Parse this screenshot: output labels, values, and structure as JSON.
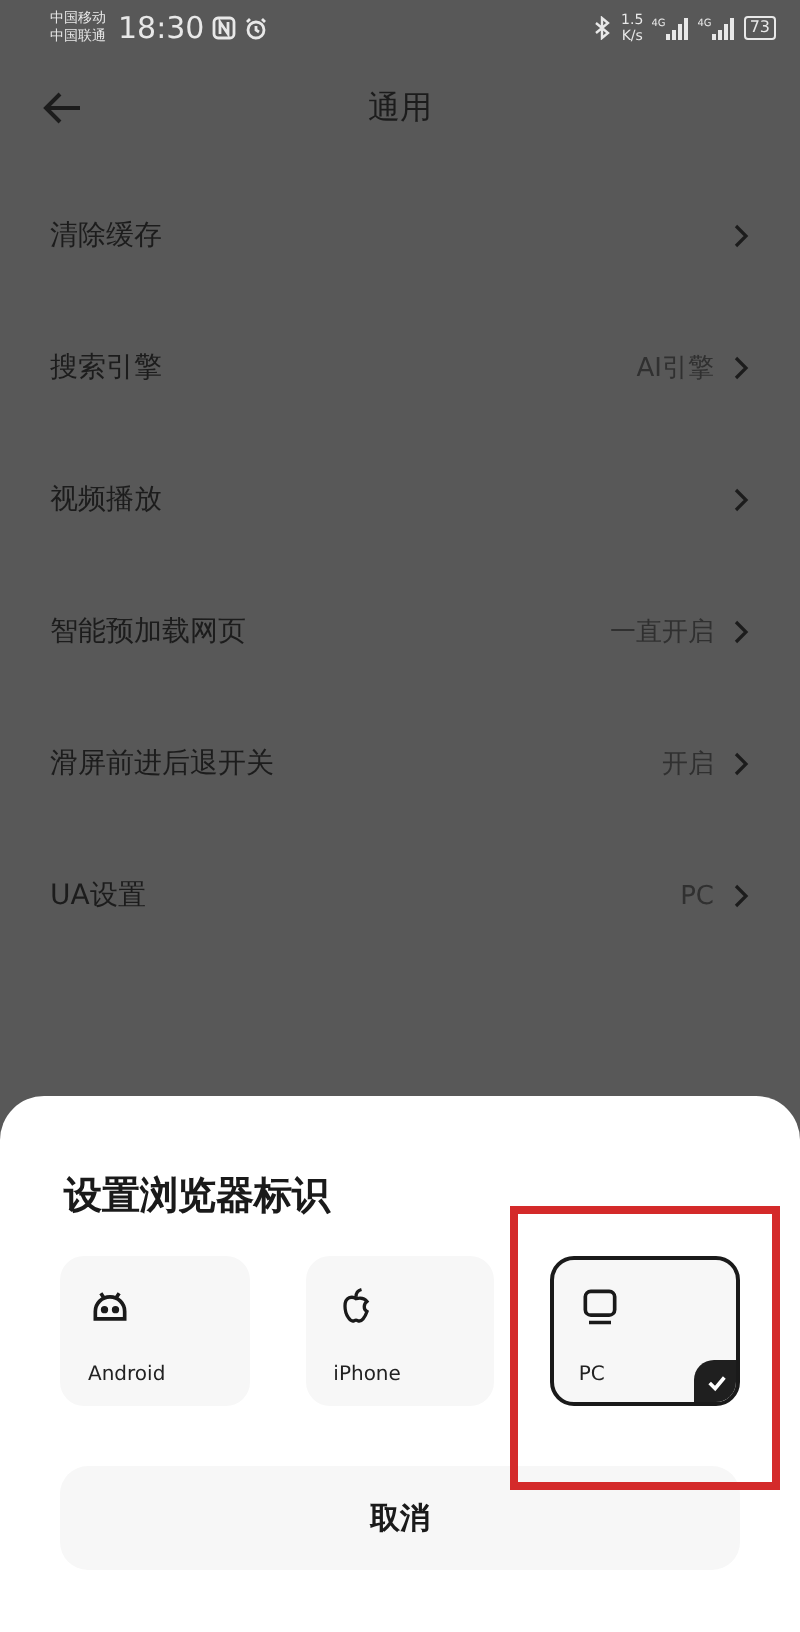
{
  "status_bar": {
    "carriers": [
      "中国移动",
      "中国联通"
    ],
    "time": "18:30",
    "speed": "1.5",
    "speed_unit": "K/s",
    "network_labels": [
      "4G",
      "4G"
    ],
    "battery": "73"
  },
  "header": {
    "title": "通用"
  },
  "settings": [
    {
      "label": "清除缓存"
    },
    {
      "label": "搜索引擎",
      "value": "AI引擎"
    },
    {
      "label": "视频播放"
    },
    {
      "label": "智能预加载网页",
      "value": "一直开启"
    },
    {
      "label": "滑屏前进后退开关",
      "value": "开启"
    },
    {
      "label": "UA设置",
      "value": "PC"
    }
  ],
  "sheet": {
    "title": "设置浏览器标识",
    "options": [
      {
        "kind": "android",
        "label": "Android",
        "selected": false
      },
      {
        "kind": "apple",
        "label": "iPhone",
        "selected": false
      },
      {
        "kind": "pc",
        "label": "PC",
        "selected": true
      }
    ],
    "cancel": "取消"
  }
}
